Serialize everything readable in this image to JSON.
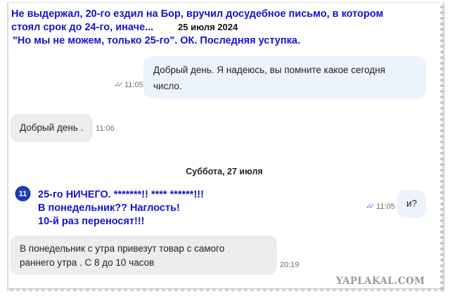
{
  "caption": {
    "line1": "Не выдержал, 20-го ездил на Бор, вручил досудебное письмо, в котором",
    "line2": "стоял срок до 24-го, иначе...",
    "line3": "\"Но мы не можем, только 25-го\". ОК. Последняя уступка.",
    "color": "#1414cc"
  },
  "chat": {
    "header_date": "25 июля 2024",
    "day_separator": "Суббота, 27 июля",
    "messages": [
      {
        "direction": "outgoing",
        "lines": [
          "Добрый день. Я надеюсь, вы помните какое сегодня",
          "число."
        ],
        "time": "11:05",
        "read_icon": "double-check-icon"
      },
      {
        "direction": "incoming",
        "lines": [
          "Добрый день ."
        ],
        "time": "11:06"
      },
      {
        "direction": "outgoing",
        "lines": [
          "и?"
        ],
        "time": "11:05",
        "read_icon": "double-check-icon"
      },
      {
        "direction": "incoming",
        "lines": [
          "В понедельник с утра привезут товар  с самого",
          "раннего утра . С 8 до 10 часов"
        ],
        "time": "20:19"
      }
    ]
  },
  "annotation": {
    "badge": "11",
    "line1": "25-го НИЧЕГО. *******!! **** ******!!!",
    "line2": "В понедельник?? Наглость!",
    "line3": "10-й раз переносят!!!"
  },
  "watermark": "YAPLAKAL.COM",
  "colors": {
    "outgoing_bubble": "#ecf3fd",
    "incoming_bubble": "#ededed",
    "check_marks": "#5b8fd6",
    "badge": "#1f3bb5"
  }
}
